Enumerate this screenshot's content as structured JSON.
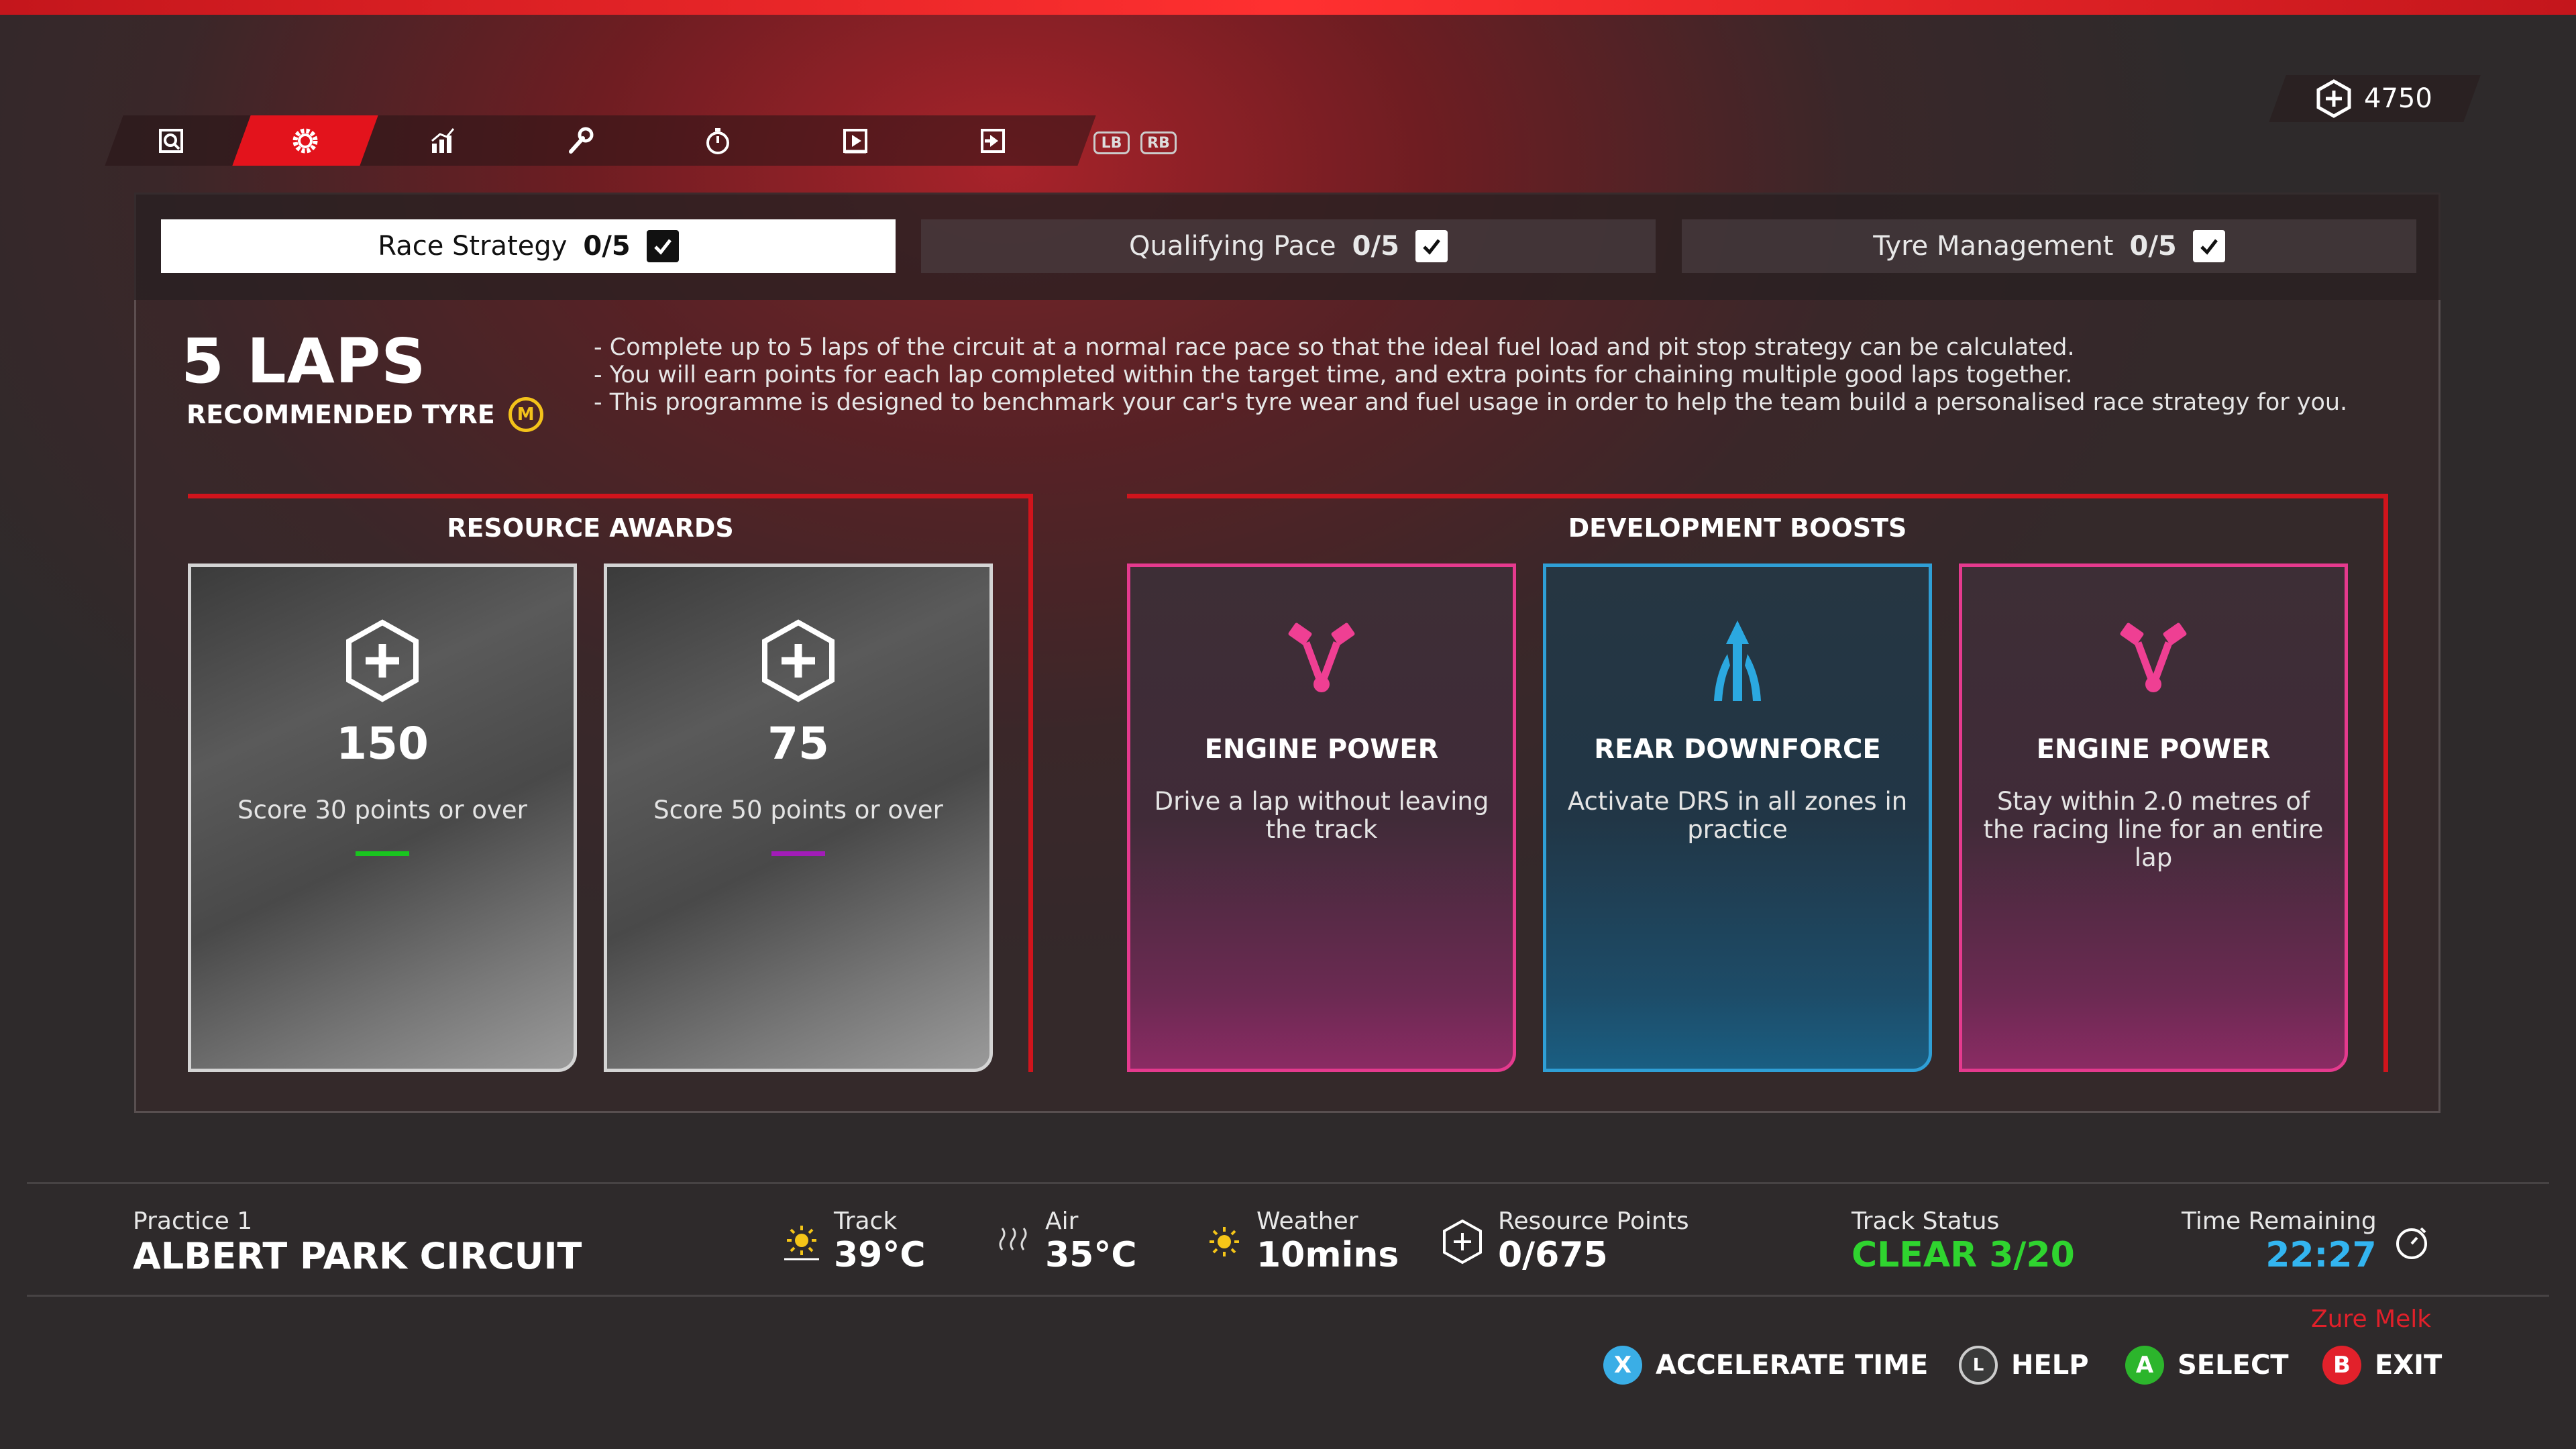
{
  "header": {
    "resource_points_total": "4750",
    "nav_tabs": [
      {
        "name": "search-icon"
      },
      {
        "name": "gear-icon",
        "active": true
      },
      {
        "name": "chart-icon"
      },
      {
        "name": "wrench-icon"
      },
      {
        "name": "stopwatch-icon"
      },
      {
        "name": "play-icon"
      },
      {
        "name": "exit-arrow-icon"
      }
    ],
    "bumpers": [
      "LB",
      "RB"
    ]
  },
  "subtabs": [
    {
      "label": "Race Strategy",
      "count": "0/5",
      "active": true
    },
    {
      "label": "Qualifying Pace",
      "count": "0/5",
      "active": false
    },
    {
      "label": "Tyre Management",
      "count": "0/5",
      "active": false
    }
  ],
  "programme": {
    "laps": "5 LAPS",
    "recommended_tyre_label": "RECOMMENDED TYRE",
    "tyre_compound": "M",
    "description": [
      "- Complete up to 5 laps of the circuit at a normal race pace so that the ideal fuel load and pit stop strategy can be calculated.",
      "- You will earn points for each lap completed within the target time, and extra points for chaining multiple good laps together.",
      "- This programme is designed to benchmark your car's tyre wear and fuel usage in order to help the team build a personalised race strategy for you."
    ]
  },
  "resource_awards": {
    "title": "RESOURCE AWARDS",
    "cards": [
      {
        "value": "150",
        "desc": "Score 30 points or over",
        "bar_color": "#19c51f"
      },
      {
        "value": "75",
        "desc": "Score 50 points or over",
        "bar_color": "#a21cb8"
      }
    ]
  },
  "development_boosts": {
    "title": "DEVELOPMENT BOOSTS",
    "cards": [
      {
        "title": "ENGINE POWER",
        "desc": "Drive a lap without leaving the track",
        "icon": "engine-piston-icon",
        "color": "#ef3f93"
      },
      {
        "title": "REAR DOWNFORCE",
        "desc": "Activate DRS in all zones in practice",
        "icon": "downforce-arrow-icon",
        "color": "#2ba8e0"
      },
      {
        "title": "ENGINE POWER",
        "desc": "Stay within 2.0 metres of the racing line for an entire lap",
        "icon": "engine-piston-icon",
        "color": "#ef3f93"
      }
    ]
  },
  "session": {
    "name": "Practice 1",
    "circuit": "ALBERT PARK CIRCUIT",
    "track_label": "Track",
    "track_temp": "39°C",
    "air_label": "Air",
    "air_temp": "35°C",
    "weather_label": "Weather",
    "weather_value": "10mins",
    "resource_label": "Resource Points",
    "resource_value": "0/675",
    "status_label": "Track Status",
    "status_value": "CLEAR 3/20",
    "status_color": "#2fd42f",
    "time_label": "Time Remaining",
    "time_value": "22:27",
    "time_color": "#33b5f0"
  },
  "user": "Zure Melk",
  "prompts": [
    {
      "glyph": "X",
      "label": "ACCELERATE TIME",
      "color": "#3aaee6"
    },
    {
      "glyph": "L",
      "label": "HELP",
      "color": "#3a3a3a"
    },
    {
      "glyph": "A",
      "label": "SELECT",
      "color": "#2cb52c"
    },
    {
      "glyph": "B",
      "label": "EXIT",
      "color": "#e2212b"
    }
  ]
}
